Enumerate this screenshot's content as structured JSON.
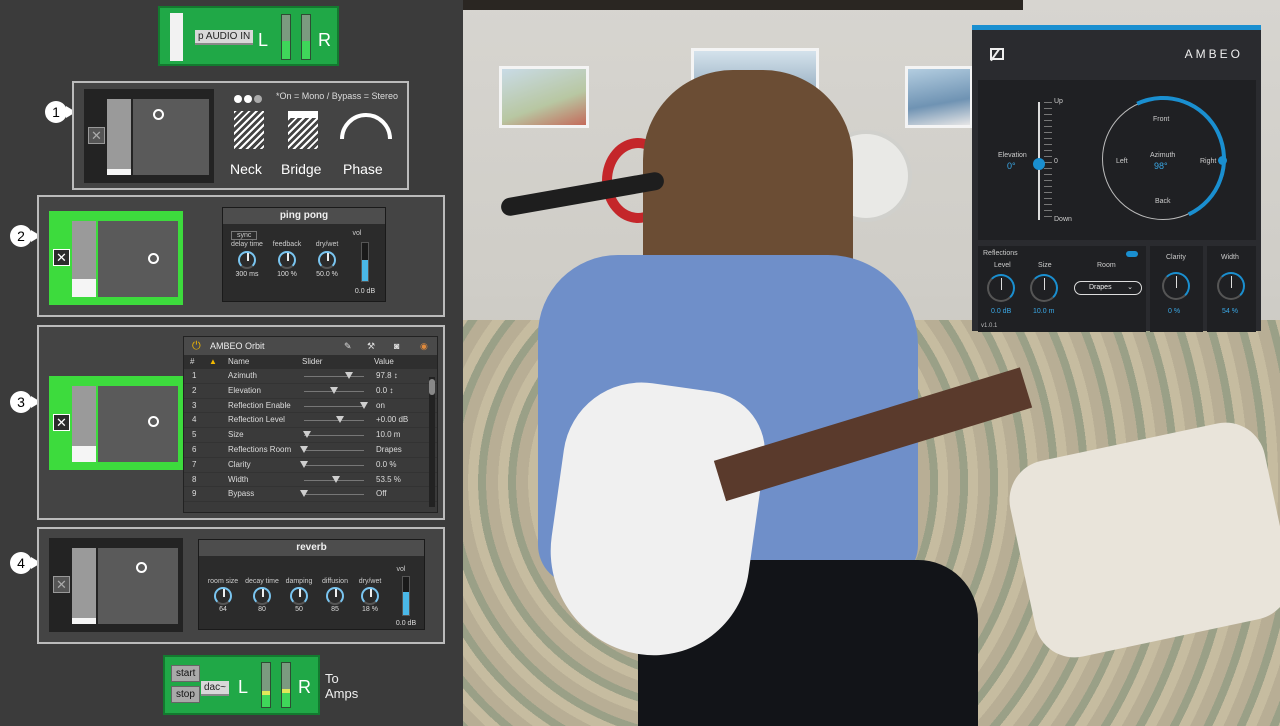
{
  "audio_in": {
    "label": "p AUDIO IN",
    "left": "L",
    "right": "R"
  },
  "output": {
    "start": "start",
    "stop": "stop",
    "label": "dac~",
    "left": "L",
    "right": "R",
    "to": "To",
    "amps": "Amps"
  },
  "steps": [
    "1",
    "2",
    "3",
    "4"
  ],
  "panel1": {
    "note": "*On = Mono / Bypass = Stereo",
    "neck": "Neck",
    "bridge": "Bridge",
    "phase": "Phase"
  },
  "ping_pong": {
    "title": "ping pong",
    "sync": "sync",
    "knobs": [
      {
        "label": "delay time",
        "value": "300 ms"
      },
      {
        "label": "feedback",
        "value": "100 %"
      },
      {
        "label": "dry/wet",
        "value": "50.0 %"
      }
    ],
    "vol_label": "vol",
    "vol_value": "0.0 dB",
    "vol_level": 0.55
  },
  "orbit": {
    "title": "AMBEO Orbit",
    "columns": [
      "#",
      "Name",
      "Slider",
      "Value"
    ],
    "rows": [
      {
        "n": "1",
        "name": "Azimuth",
        "value": "97.8 ↕",
        "pos": 0.75
      },
      {
        "n": "2",
        "name": "Elevation",
        "value": "0.0 ↕",
        "pos": 0.5
      },
      {
        "n": "3",
        "name": "Reflection Enable",
        "value": "on",
        "pos": 1.0
      },
      {
        "n": "4",
        "name": "Reflection Level",
        "value": "+0.00 dB",
        "pos": 0.6
      },
      {
        "n": "5",
        "name": "Size",
        "value": "10.0 m",
        "pos": 0.05
      },
      {
        "n": "6",
        "name": "Reflections Room",
        "value": "Drapes",
        "pos": 0.0
      },
      {
        "n": "7",
        "name": "Clarity",
        "value": "0.0 %",
        "pos": 0.0
      },
      {
        "n": "8",
        "name": "Width",
        "value": "53.5 %",
        "pos": 0.53
      },
      {
        "n": "9",
        "name": "Bypass",
        "value": "Off",
        "pos": 0.0
      }
    ]
  },
  "reverb": {
    "title": "reverb",
    "knobs": [
      {
        "label": "room size",
        "value": "64"
      },
      {
        "label": "decay time",
        "value": "80"
      },
      {
        "label": "damping",
        "value": "50"
      },
      {
        "label": "diffusion",
        "value": "85"
      },
      {
        "label": "dry/wet",
        "value": "18 %"
      }
    ],
    "vol_label": "vol",
    "vol_value": "0.0 dB",
    "vol_level": 0.6
  },
  "ambeo": {
    "brand": "AMBEO",
    "elevation_label": "Elevation",
    "elevation_value": "0°",
    "up": "Up",
    "zero": "0",
    "down": "Down",
    "front": "Front",
    "back": "Back",
    "left": "Left",
    "right": "Right",
    "azimuth_label": "Azimuth",
    "azimuth_value": "98°",
    "reflections": "Reflections",
    "level": "Level",
    "size": "Size",
    "room": "Room",
    "level_value": "0.0 dB",
    "size_value": "10.0 m",
    "room_value": "Drapes",
    "clarity": "Clarity",
    "clarity_value": "0 %",
    "width": "Width",
    "width_value": "54 %",
    "version": "v1.0.1"
  },
  "colors": {
    "patch_green": "#20a847",
    "pad_active": "#3ddb3d",
    "ambeo_accent": "#1a8fd0"
  }
}
